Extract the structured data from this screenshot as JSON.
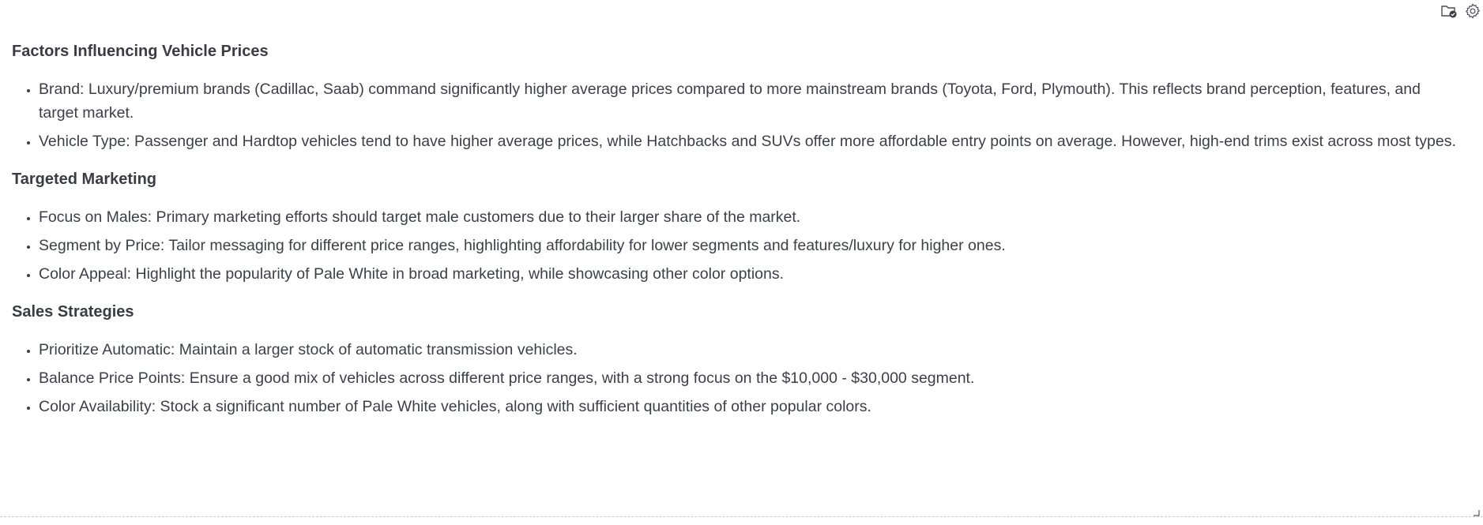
{
  "toolbar": {
    "icons": [
      "folder-check-icon",
      "gear-icon"
    ]
  },
  "sections": [
    {
      "heading": "Factors Influencing Vehicle Prices",
      "items": [
        "Brand: Luxury/premium brands (Cadillac, Saab) command significantly higher average prices compared to more mainstream brands (Toyota, Ford, Plymouth). This reflects brand perception, features, and target market.",
        "Vehicle Type: Passenger and Hardtop vehicles tend to have higher average prices, while Hatchbacks and SUVs offer more affordable entry points on average. However, high-end trims exist across most types."
      ]
    },
    {
      "heading": "Targeted Marketing",
      "items": [
        "Focus on Males: Primary marketing efforts should target male customers due to their larger share of the market.",
        "Segment by Price: Tailor messaging for different price ranges, highlighting affordability for lower segments and features/luxury for higher ones.",
        "Color Appeal: Highlight the popularity of Pale White in broad marketing, while showcasing other color options."
      ]
    },
    {
      "heading": "Sales Strategies",
      "items": [
        "Prioritize Automatic: Maintain a larger stock of automatic transmission vehicles.",
        "Balance Price Points: Ensure a good mix of vehicles across different price ranges, with a strong focus on the $10,000 - $30,000 segment.",
        "Color Availability: Stock a significant number of Pale White vehicles, along with sufficient quantities of other popular colors."
      ]
    }
  ]
}
